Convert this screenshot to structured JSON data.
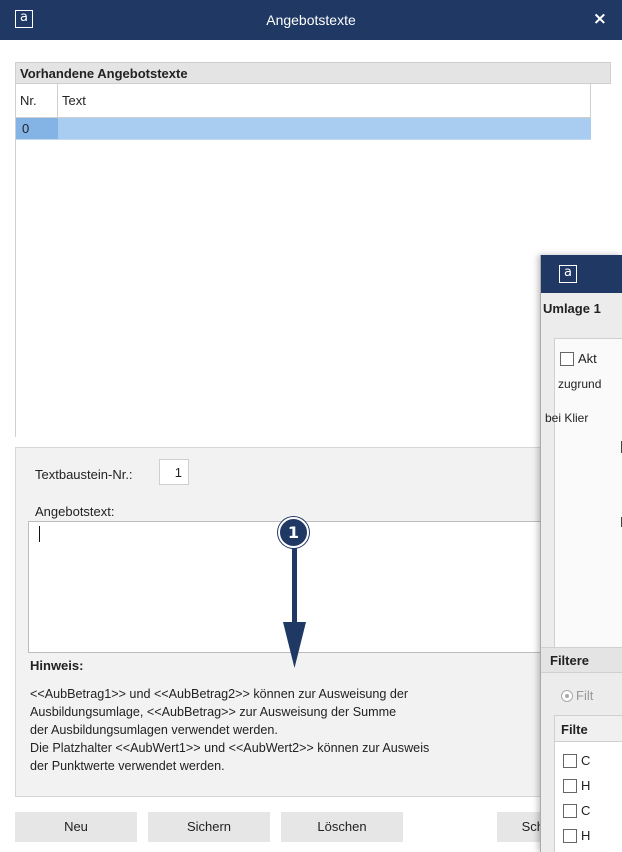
{
  "window": {
    "title": "Angebotstexte",
    "logo": "a",
    "close": "×"
  },
  "list": {
    "heading": "Vorhandene Angebotstexte",
    "columns": {
      "nr": "Nr.",
      "text": "Text"
    },
    "rows": [
      {
        "nr": "0",
        "text": ""
      }
    ]
  },
  "form": {
    "textbaustein_label": "Textbaustein-Nr.:",
    "textbaustein_value": "1",
    "angebotstext_label": "Angebotstext:",
    "angebotstext_value": "",
    "hint_title": "Hinweis:",
    "hint_lines": [
      "<<AubBetrag1>> und <<AubBetrag2>> können zur Ausweisung der",
      "Ausbildungsumlage, <<AubBetrag>> zur Ausweisung der Summe",
      "der Ausbildungsumlagen verwendet werden.",
      "Die Platzhalter <<AubWert1>> und <<AubWert2>> können zur Ausweis",
      "der Punktwerte verwendet werden."
    ]
  },
  "buttons": {
    "neu": "Neu",
    "sichern": "Sichern",
    "loeschen": "Löschen",
    "partial": "Sch"
  },
  "callout": {
    "number": "1"
  },
  "second_dialog": {
    "logo": "a",
    "heading": "Umlage 1",
    "checkbox_label": "Akt",
    "text_zugrunde": "zugrund",
    "text_bei": "bei Klier",
    "filter_heading": "Filtere",
    "radio_label": "Filt",
    "list_heading": "Filte",
    "items": [
      "C",
      "H",
      "C",
      "H"
    ]
  },
  "colors": {
    "titlebar": "#1f3864",
    "selection": "#a9cdf1",
    "selection_cell": "#84b4e6",
    "arrow": "#1f3864"
  }
}
